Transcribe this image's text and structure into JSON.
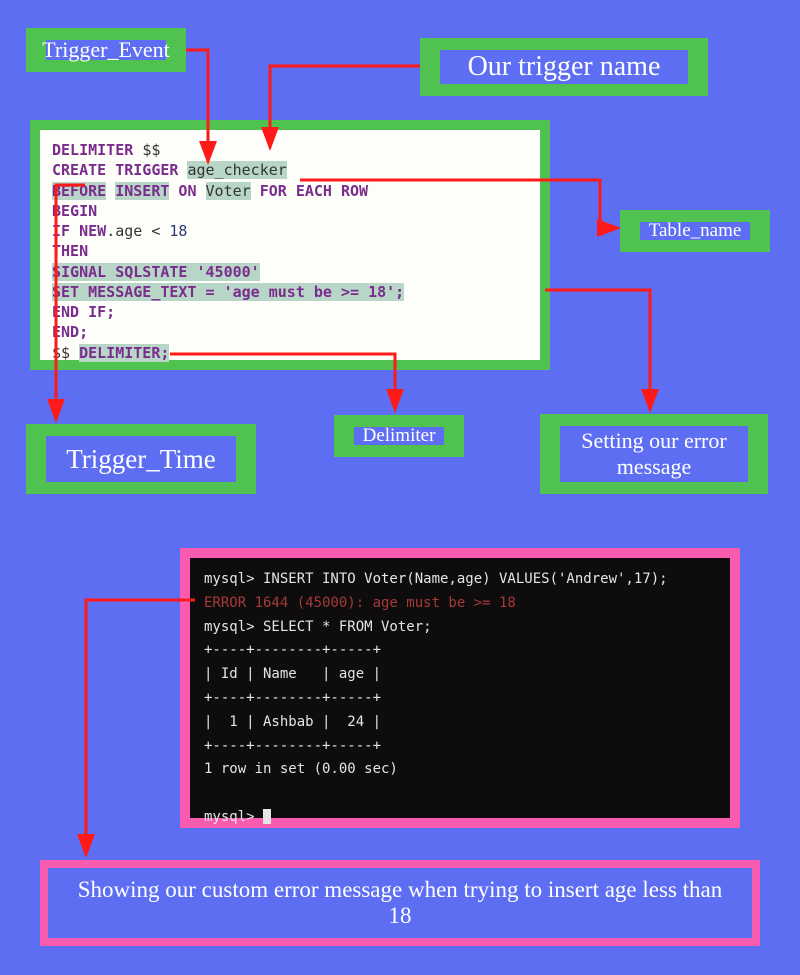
{
  "labels": {
    "trigger_event": "Trigger_Event",
    "trigger_name": "Our trigger name",
    "table_name": "Table_name",
    "trigger_time": "Trigger_Time",
    "delimiter": "Delimiter",
    "error_msg_label": "Setting our error message",
    "bottom_caption": "Showing our custom error message when trying to insert age less than 18"
  },
  "code": {
    "l1a": "DELIMITER ",
    "l1b": "$$",
    "l2a": "  CREATE TRIGGER ",
    "l2b": "age_checker",
    "l3a": "      ",
    "l3b": "BEFORE",
    "l3c": " ",
    "l3d": "INSERT",
    "l3e": " ON ",
    "l3f": "Voter",
    "l3g": "  FOR EACH ROW",
    "l4": "      BEGIN",
    "l5a": "          IF ",
    "l5b": "NEW",
    "l5c": ".age < ",
    "l5d": "18",
    "l6": "          THEN",
    "l7": "              SIGNAL SQLSTATE '45000'",
    "l8": "                  SET MESSAGE_TEXT = 'age must be >= 18';",
    "l9": "          END IF;",
    "l10": "      END;",
    "l11a": "$$ ",
    "l11b": "DELIMITER;"
  },
  "terminal": {
    "l1": "mysql> INSERT INTO Voter(Name,age) VALUES('Andrew',17);",
    "l2": "ERROR 1644 (45000): age must be >= 18",
    "l3": "mysql> SELECT * FROM Voter;",
    "l4": "+----+--------+-----+",
    "l5": "| Id | Name   | age |",
    "l6": "+----+--------+-----+",
    "l7": "|  1 | Ashbab |  24 |",
    "l8": "+----+--------+-----+",
    "l9": "1 row in set (0.00 sec)",
    "l10": "",
    "l11": "mysql> "
  }
}
